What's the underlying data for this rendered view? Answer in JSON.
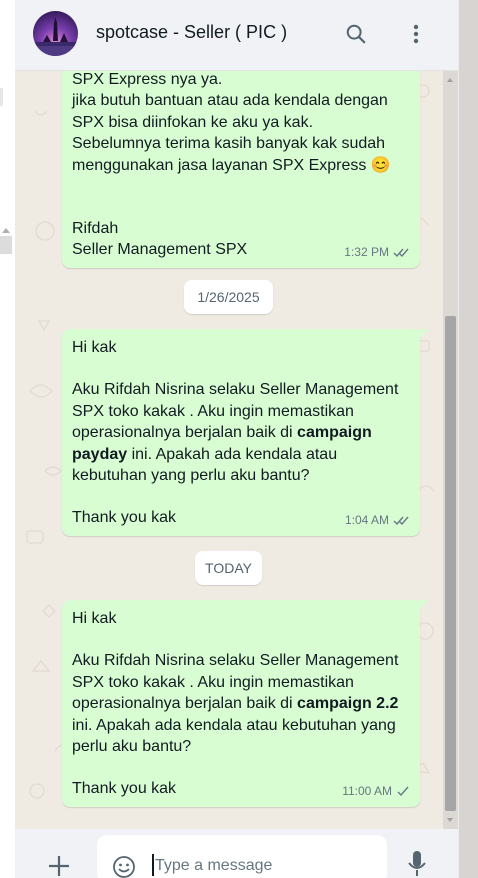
{
  "header": {
    "title": "spotcase - Seller ( PIC )"
  },
  "icons": {
    "search": "search-icon",
    "menu": "more-vertical-icon",
    "attach": "plus-icon",
    "emoji": "emoji-icon",
    "mic": "mic-icon",
    "read_receipt": "double-check-icon",
    "sent_receipt": "single-check-icon"
  },
  "messages": [
    {
      "partial_top": "SPX Express nya ya.",
      "lines": [
        "jika butuh bantuan atau ada kendala dengan",
        "SPX bisa diinfokan ke aku ya kak.",
        "Sebelumnya terima kasih banyak kak sudah",
        "menggunakan jasa layanan SPX Express 😊",
        "Rifdah",
        "Seller Management SPX"
      ],
      "time": "1:32 PM",
      "status": "read"
    },
    {
      "greeting": "Hi kak",
      "body_pre": "Aku Rifdah Nisrina selaku Seller Management SPX toko kakak . Aku ingin memastikan operasionalnya berjalan baik di ",
      "bold": "campaign payday",
      "body_post": " ini. Apakah ada kendala atau kebutuhan yang perlu aku bantu?",
      "closing": "Thank you kak",
      "time": "1:04 AM",
      "status": "read"
    },
    {
      "greeting": "Hi kak",
      "body_pre": "Aku Rifdah Nisrina selaku Seller Management SPX toko kakak . Aku ingin memastikan operasionalnya berjalan baik di ",
      "bold": "campaign 2.2",
      "body_post": " ini. Apakah ada kendala atau kebutuhan yang perlu aku bantu?",
      "closing": "Thank you kak",
      "time": "11:00 AM",
      "status": "sent"
    }
  ],
  "date_separators": [
    "1/26/2025",
    "TODAY"
  ],
  "composer": {
    "placeholder": "Type a message"
  },
  "colors": {
    "outgoing_bubble": "#d9fdd3",
    "chat_background": "#efeae2",
    "header_background": "#f0f2f5",
    "read_check": "#667781"
  }
}
